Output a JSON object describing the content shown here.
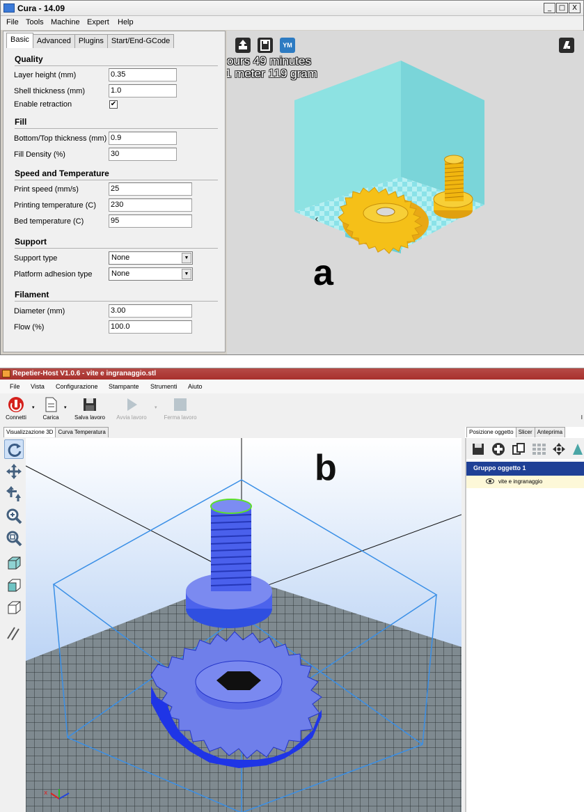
{
  "cura": {
    "window_title": "Cura - 14.09",
    "window_buttons": {
      "minimize": "_",
      "maximize": "□",
      "close": "X"
    },
    "menu": [
      "File",
      "Tools",
      "Machine",
      "Expert",
      "Help"
    ],
    "tabs": [
      "Basic",
      "Advanced",
      "Plugins",
      "Start/End-GCode"
    ],
    "active_tab": "Basic",
    "sections": {
      "quality": {
        "title": "Quality",
        "layer_height": {
          "label": "Layer height (mm)",
          "value": "0.35"
        },
        "shell_thickness": {
          "label": "Shell thickness (mm)",
          "value": "1.0"
        },
        "enable_retraction": {
          "label": "Enable retraction",
          "checked": true,
          "mark": "✔"
        }
      },
      "fill": {
        "title": "Fill",
        "bottom_top": {
          "label": "Bottom/Top thickness (mm)",
          "value": "0.9"
        },
        "fill_density": {
          "label": "Fill Density (%)",
          "value": "30"
        }
      },
      "speed": {
        "title": "Speed and Temperature",
        "print_speed": {
          "label": "Print speed (mm/s)",
          "value": "25"
        },
        "printing_temp": {
          "label": "Printing temperature (C)",
          "value": "230"
        },
        "bed_temp": {
          "label": "Bed temperature (C)",
          "value": "95"
        }
      },
      "support": {
        "title": "Support",
        "support_type": {
          "label": "Support type",
          "value": "None"
        },
        "platform_adhesion": {
          "label": "Platform adhesion type",
          "value": "None"
        }
      },
      "filament": {
        "title": "Filament",
        "diameter": {
          "label": "Diameter (mm)",
          "value": "3.00"
        },
        "flow": {
          "label": "Flow (%)",
          "value": "100.0"
        }
      }
    },
    "viewport": {
      "print_time": "ours 49 minutes",
      "material": "1 meter 119 gram",
      "ym_label": "YM",
      "panel_letter": "a"
    }
  },
  "repetier": {
    "window_title": "Repetier-Host V1.0.6 - vite e ingranaggio.stl",
    "menu": [
      "File",
      "Vista",
      "Configurazione",
      "Stampante",
      "Strumenti",
      "Aiuto"
    ],
    "toolbar": {
      "connect": "Connetti",
      "load": "Carica",
      "save_job": "Salva lavoro",
      "start_job": "Avvia lavoro",
      "stop_job": "Ferma lavoro",
      "overflow": "I"
    },
    "tabs": [
      "Visualizzazione 3D",
      "Curva Temperatura"
    ],
    "right_tabs": [
      "Posizione oggetto",
      "Slicer",
      "Anteprima"
    ],
    "object_group": "Gruppo oggetto 1",
    "object_name": "vite e ingranaggio",
    "panel_letter": "b"
  },
  "colors": {
    "cura_model": "#f5c018",
    "cura_box": "#7fe3e3",
    "repetier_model": "#6f7fea",
    "repetier_bed": "#7f8a90",
    "repetier_bg_top": "#ffffff",
    "repetier_bg_bottom": "#8fb7ee",
    "group_header": "#1f4096",
    "bbox_line": "#3a8fe6"
  }
}
